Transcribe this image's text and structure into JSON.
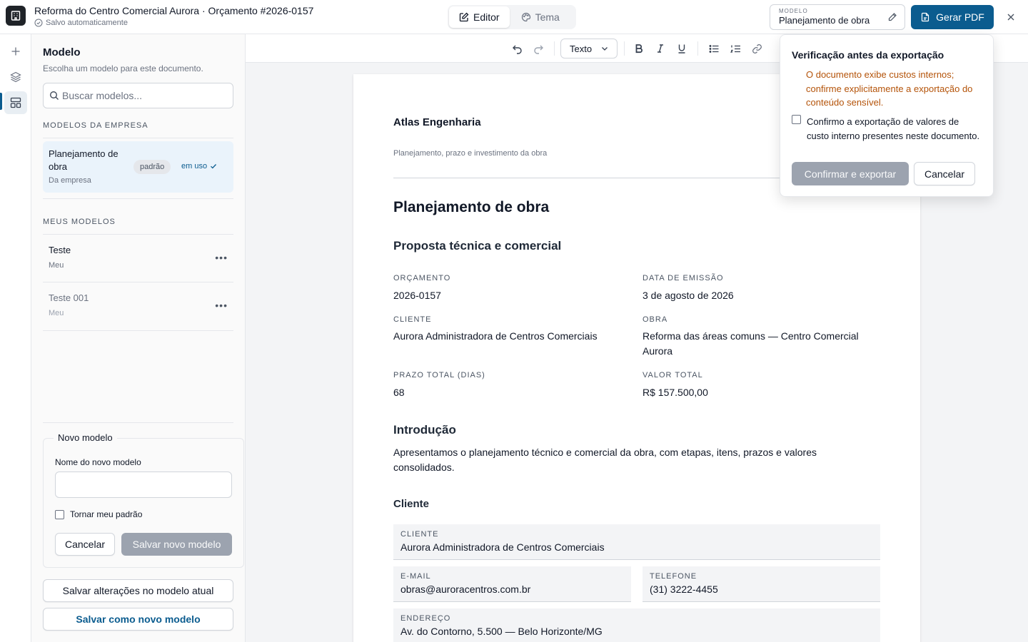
{
  "header": {
    "title": "Reforma do Centro Comercial Aurora · Orçamento #2026-0157",
    "status": "Salvo automaticamente",
    "tabs": [
      {
        "label": "Editor",
        "active": true
      },
      {
        "label": "Tema",
        "active": false
      }
    ],
    "model_select": {
      "label": "MODELO",
      "value": "Planejamento de obra"
    },
    "pdf_button": "Gerar PDF",
    "accent_color": "#0b5c8f"
  },
  "sidebar": {
    "title": "Modelo",
    "subtitle": "Escolha um modelo para este documento.",
    "search_placeholder": "Buscar modelos...",
    "company_section": "MODELOS DA EMPRESA",
    "company_templates": [
      {
        "name": "Planejamento de obra",
        "origin": "Da empresa",
        "badge": "padrão",
        "status": "em uso"
      }
    ],
    "my_section": "MEUS MODELOS",
    "my_templates": [
      {
        "name": "Teste",
        "origin": "Meu"
      },
      {
        "name": "Teste 001",
        "origin": "Meu"
      }
    ],
    "new_model": {
      "legend": "Novo modelo",
      "name_label": "Nome do novo modelo",
      "name_value": "",
      "default_checkbox": "Tornar meu padrão",
      "cancel": "Cancelar",
      "save": "Salvar novo modelo"
    },
    "save_changes": "Salvar alterações no modelo atual",
    "save_as_new": "Salvar como novo modelo"
  },
  "toolbar": {
    "text_style": "Texto"
  },
  "document": {
    "company": "Atlas Engenharia",
    "tagline": "Planejamento, prazo e investimento da obra",
    "title": "Planejamento de obra",
    "subtitle": "Proposta técnica e comercial",
    "meta": [
      {
        "label": "ORÇAMENTO",
        "value": "2026-0157"
      },
      {
        "label": "DATA DE EMISSÃO",
        "value": "3 de agosto de 2026"
      },
      {
        "label": "CLIENTE",
        "value": "Aurora Administradora de Centros Comerciais"
      },
      {
        "label": "OBRA",
        "value": "Reforma das áreas comuns — Centro Comercial Aurora"
      },
      {
        "label": "PRAZO TOTAL (DIAS)",
        "value": "68"
      },
      {
        "label": "VALOR TOTAL",
        "value": "R$ 157.500,00"
      }
    ],
    "intro_heading": "Introdução",
    "intro_text": "Apresentamos o planejamento técnico e comercial da obra, com etapas, itens, prazos e valores consolidados.",
    "client_heading": "Cliente",
    "client": {
      "client": {
        "label": "CLIENTE",
        "value": "Aurora Administradora de Centros Comerciais"
      },
      "email": {
        "label": "E-MAIL",
        "value": "obras@auroracentros.com.br"
      },
      "phone": {
        "label": "TELEFONE",
        "value": "(31) 3222-4455"
      },
      "address": {
        "label": "ENDEREÇO",
        "value": "Av. do Contorno, 5.500 — Belo Horizonte/MG"
      }
    }
  },
  "export_popover": {
    "title": "Verificação antes da exportação",
    "warning": "O documento exibe custos internos; confirme explicitamente a exportação do conteúdo sensível.",
    "checkbox_label": "Confirmo a exportação de valores de custo interno presentes neste documento.",
    "confirm": "Confirmar e exportar",
    "cancel": "Cancelar",
    "warning_color": "#b45309"
  }
}
